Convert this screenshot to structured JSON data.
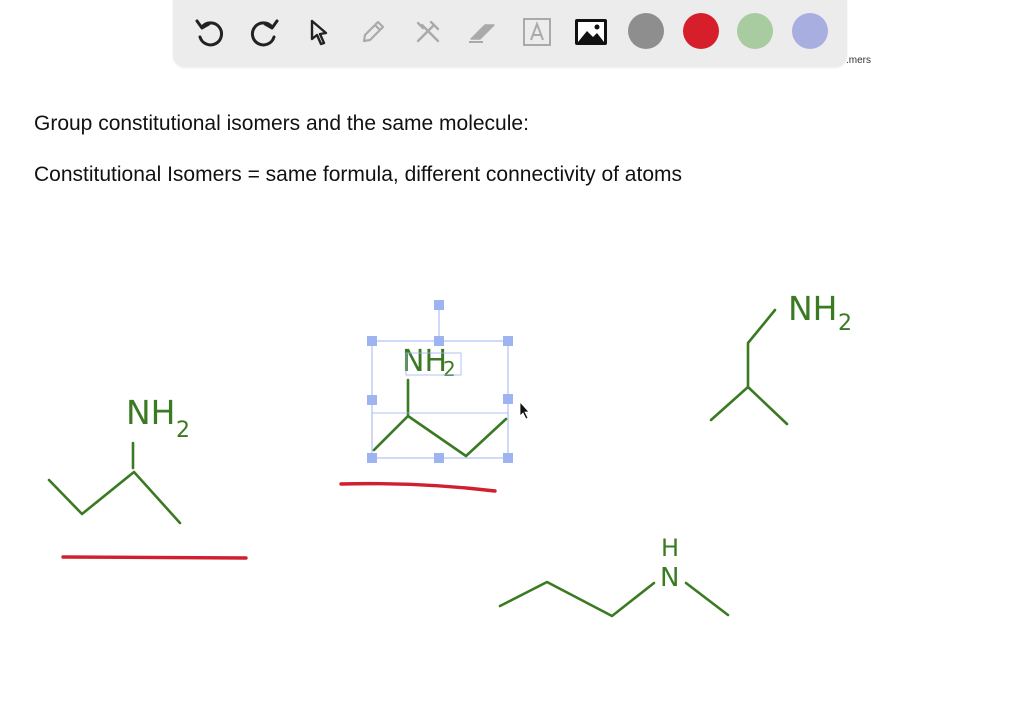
{
  "toolbar": {
    "tools": [
      {
        "name": "undo-icon"
      },
      {
        "name": "redo-icon"
      },
      {
        "name": "pointer-icon"
      },
      {
        "name": "pencil-icon"
      },
      {
        "name": "tools-icon"
      },
      {
        "name": "eraser-icon"
      },
      {
        "name": "text-icon"
      },
      {
        "name": "image-icon"
      }
    ],
    "colors": [
      "#8e8e8e",
      "#d61f2b",
      "#a8cba0",
      "#a9aee0"
    ],
    "clipped_label": "mers."
  },
  "heading": {
    "line1": "Group constitutional isomers and the same molecule:",
    "line2": "Constitutional Isomers = same formula, different connectivity of atoms"
  },
  "drawing": {
    "ink_green": "#3a7a22",
    "ink_red": "#d0202f",
    "selection_blue": "#9db4f0",
    "labels": {
      "nh": "NH",
      "two": "2",
      "h": "H",
      "n": "N"
    }
  }
}
